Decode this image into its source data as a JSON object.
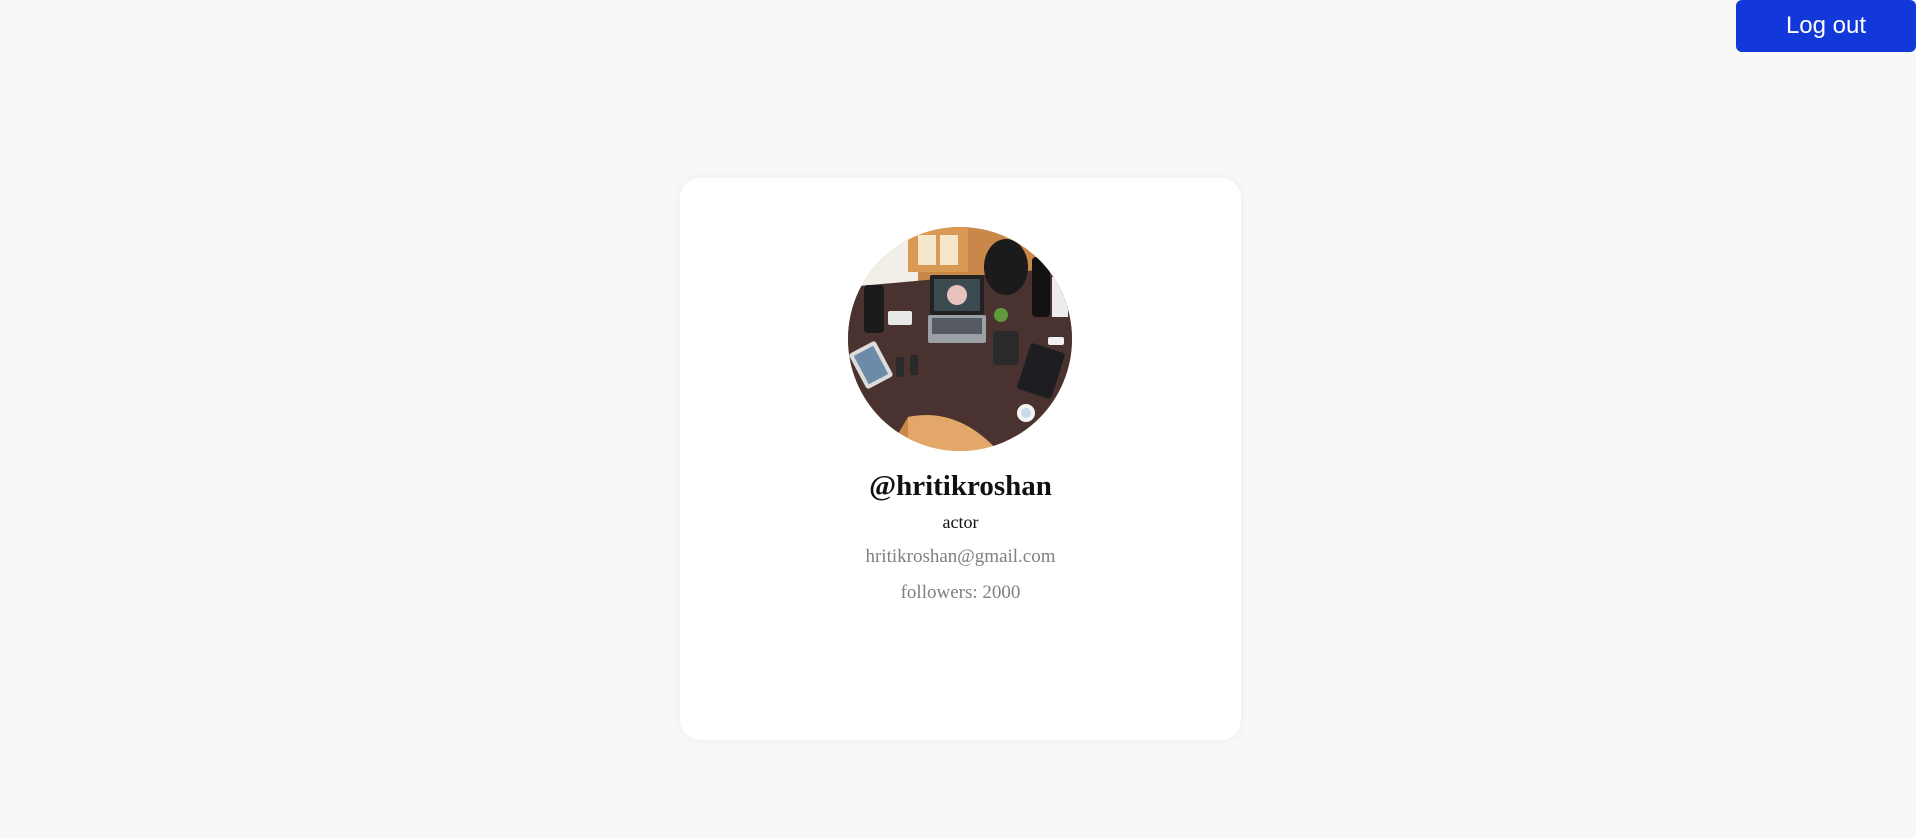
{
  "header": {
    "logout_label": "Log out"
  },
  "profile": {
    "avatar_icon": "profile-photo-desk-workspace",
    "username": "@hritikroshan",
    "role": "actor",
    "email": "hritikroshan@gmail.com",
    "followers_label": "followers:",
    "followers_count": "2000"
  },
  "colors": {
    "accent": "#1238d9",
    "background": "#f8f8f8",
    "card": "#ffffff",
    "muted_text": "#808080"
  }
}
